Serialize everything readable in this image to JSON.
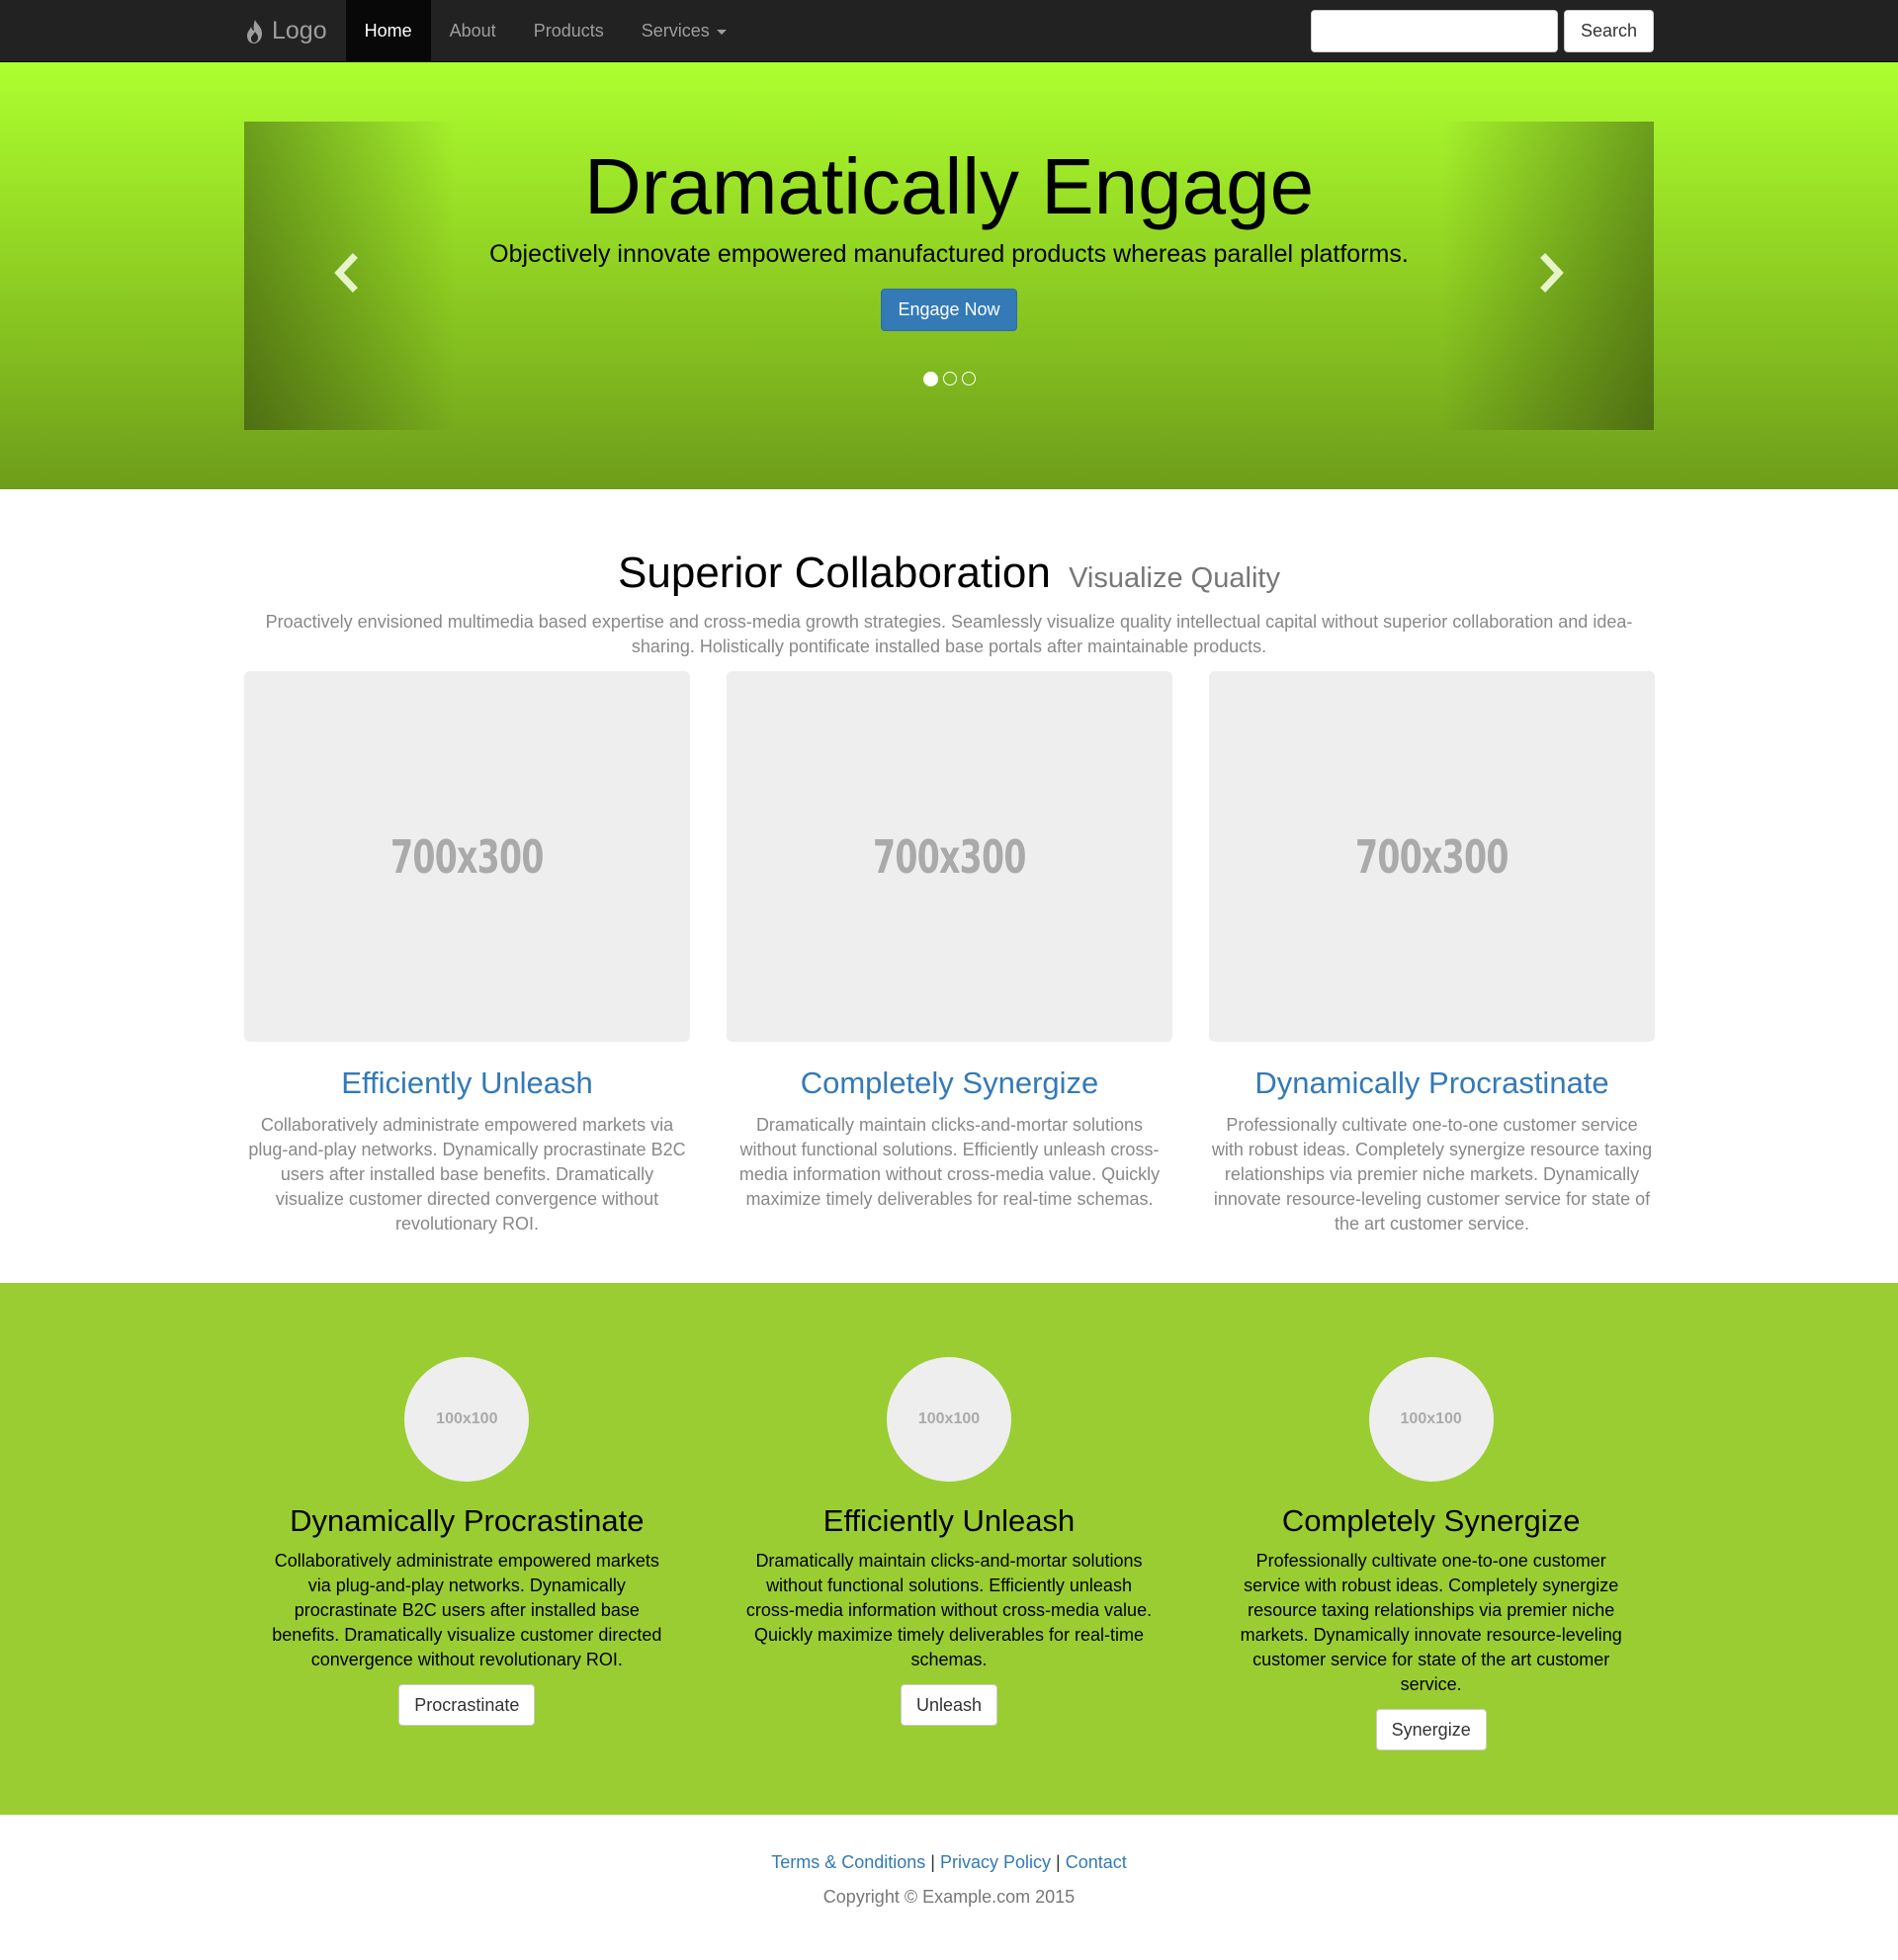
{
  "navbar": {
    "brand": "Logo",
    "items": [
      {
        "label": "Home"
      },
      {
        "label": "About"
      },
      {
        "label": "Products"
      },
      {
        "label": "Services"
      }
    ],
    "search_placeholder": "",
    "search_button": "Search"
  },
  "hero": {
    "title": "Dramatically Engage",
    "subtitle": "Objectively innovate empowered manufactured products whereas parallel platforms.",
    "button": "Engage Now",
    "slide_count": 3,
    "active_slide": 1
  },
  "features": {
    "heading": "Superior Collaboration",
    "heading_small": "Visualize Quality",
    "lead": "Proactively envisioned multimedia based expertise and cross-media growth strategies. Seamlessly visualize quality intellectual capital without superior collaboration and idea-sharing. Holistically pontificate installed base portals after maintainable products.",
    "cards": [
      {
        "image_label": "700x300",
        "title": "Efficiently Unleash",
        "text": "Collaboratively administrate empowered markets via plug-and-play networks. Dynamically procrastinate B2C users after installed base benefits. Dramatically visualize customer directed convergence without revolutionary ROI."
      },
      {
        "image_label": "700x300",
        "title": "Completely Synergize",
        "text": "Dramatically maintain clicks-and-mortar solutions without functional solutions. Efficiently unleash cross-media information without cross-media value. Quickly maximize timely deliverables for real-time schemas."
      },
      {
        "image_label": "700x300",
        "title": "Dynamically Procrastinate",
        "text": "Professionally cultivate one-to-one customer service with robust ideas. Completely synergize resource taxing relationships via premier niche markets. Dynamically innovate resource-leveling customer service for state of the art customer service."
      }
    ]
  },
  "services": [
    {
      "image_label": "100x100",
      "title": "Dynamically Procrastinate",
      "text": "Collaboratively administrate empowered markets via plug-and-play networks. Dynamically procrastinate B2C users after installed base benefits. Dramatically visualize customer directed convergence without revolutionary ROI.",
      "button": "Procrastinate"
    },
    {
      "image_label": "100x100",
      "title": "Efficiently Unleash",
      "text": "Dramatically maintain clicks-and-mortar solutions without functional solutions. Efficiently unleash cross-media information without cross-media value. Quickly maximize timely deliverables for real-time schemas.",
      "button": "Unleash"
    },
    {
      "image_label": "100x100",
      "title": "Completely Synergize",
      "text": "Professionally cultivate one-to-one customer service with robust ideas. Completely synergize resource taxing relationships via premier niche markets. Dynamically innovate resource-leveling customer service for state of the art customer service.",
      "button": "Synergize"
    }
  ],
  "footer": {
    "links": [
      "Terms & Conditions",
      "Privacy Policy",
      "Contact"
    ],
    "separator": "|",
    "copyright": "Copyright © Example.com 2015"
  },
  "colors": {
    "navbar_bg": "#222222",
    "hero_top": "#adff2f",
    "hero_bottom": "#6e9d1a",
    "section_green": "#9acd32",
    "link_blue": "#337ab7",
    "primary_button": "#337ab7"
  },
  "icons": {
    "brand": "flame-icon",
    "carousel_prev": "chevron-left-icon",
    "carousel_next": "chevron-right-icon",
    "dropdown": "caret-down-icon"
  }
}
